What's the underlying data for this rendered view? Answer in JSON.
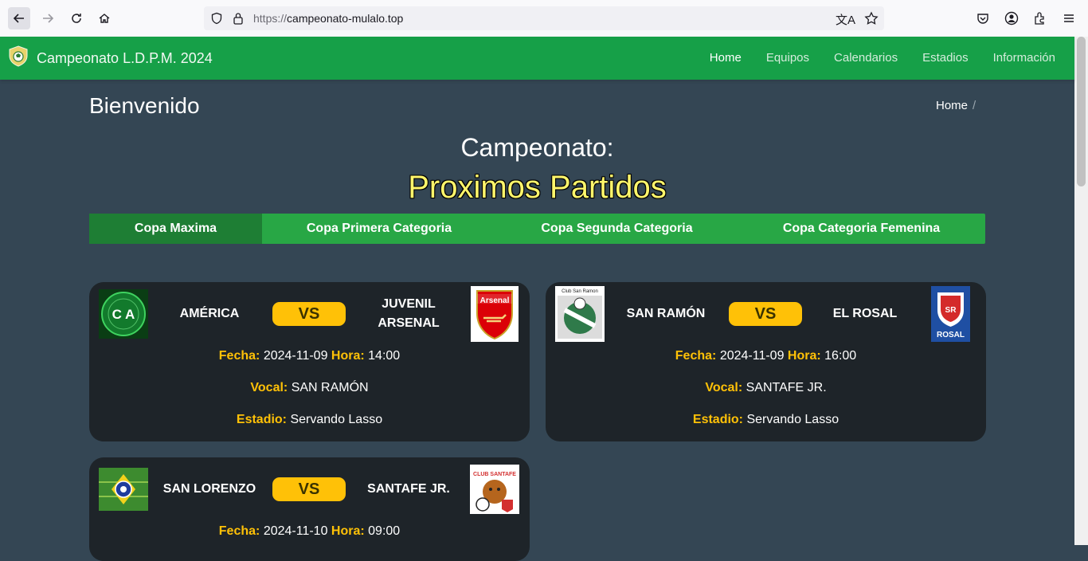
{
  "browser": {
    "url_protocol": "https://",
    "url_host": "campeonato-mulalo.top"
  },
  "site": {
    "brand": "Campeonato L.D.P.M. 2024",
    "nav": [
      "Home",
      "Equipos",
      "Calendarios",
      "Estadios",
      "Información"
    ]
  },
  "page": {
    "title": "Bienvenido",
    "breadcrumb": "Home",
    "breadcrumb_sep": "/",
    "heading1": "Campeonato:",
    "heading2": "Proximos Partidos"
  },
  "tabs": [
    "Copa Maxima",
    "Copa Primera Categoria",
    "Copa Segunda Categoria",
    "Copa Categoria Femenina"
  ],
  "labels": {
    "vs": "VS",
    "fecha": "Fecha:",
    "hora": "Hora:",
    "vocal": "Vocal:",
    "estadio": "Estadio:"
  },
  "matches": [
    {
      "home": "AMÉRICA",
      "away": "JUVENIL ARSENAL",
      "fecha": "2024-11-09",
      "hora": "14:00",
      "vocal": "SAN RAMÓN",
      "estadio": "Servando Lasso"
    },
    {
      "home": "SAN RAMÓN",
      "away": "EL ROSAL",
      "fecha": "2024-11-09",
      "hora": "16:00",
      "vocal": "SANTAFE JR.",
      "estadio": "Servando Lasso"
    },
    {
      "home": "SAN LORENZO",
      "away": "SANTAFE JR.",
      "fecha": "2024-11-10",
      "hora": "09:00"
    }
  ],
  "logo_text": {
    "america": "C A",
    "arsenal": "Arsenal",
    "san_ramon": "Club San Ramon",
    "el_rosal": "ROSAL",
    "santafe": "CLUB SANTAFE"
  },
  "colors": {
    "header_green": "#16a048",
    "tab_green": "#28a745",
    "tab_active": "#1e7e34",
    "accent_yellow": "#ffc107",
    "heading_yellow": "#fff66b",
    "page_bg": "#344654",
    "card_bg": "#1e2429"
  }
}
